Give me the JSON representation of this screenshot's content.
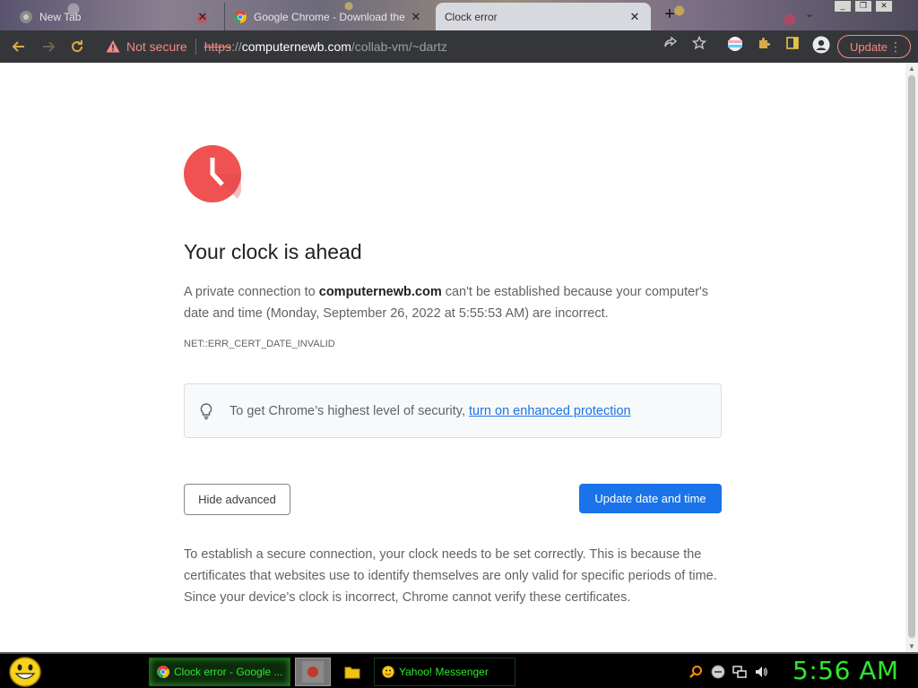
{
  "window": {
    "controls": {
      "minimize": "_",
      "restore": "❐",
      "close": "✕"
    }
  },
  "tabs": [
    {
      "title": "New Tab",
      "favicon": "chrome-gray-icon",
      "active": false
    },
    {
      "title": "Google Chrome - Download the",
      "favicon": "chrome-color-icon",
      "active": false
    },
    {
      "title": "Clock error",
      "favicon": "none",
      "active": true
    }
  ],
  "tabstrip": {
    "new_tab": "+",
    "tab_search": "⌄",
    "close_glyph": "✕"
  },
  "toolbar": {
    "security_label": "Not secure",
    "url": {
      "scheme": "https",
      "separator": "://",
      "host": "computernewb.com",
      "path": "/collab-vm/~dartz"
    },
    "update_label": "Update",
    "update_menu": "⋮"
  },
  "error_page": {
    "heading": "Your clock is ahead",
    "message_before": "A private connection to ",
    "message_host": "computernewb.com",
    "message_after": " can't be established because your computer's date and time (Monday, September 26, 2022 at 5:55:53 AM) are incorrect.",
    "error_code": "NET::ERR_CERT_DATE_INVALID",
    "enhanced_text": "To get Chrome’s highest level of security,",
    "enhanced_link": "turn on enhanced protection",
    "hide_advanced": "Hide advanced",
    "update_datetime": "Update date and time",
    "details": "To establish a secure connection, your clock needs to be set correctly. This is because the certificates that websites use to identify themselves are only valid for specific periods of time. Since your device's clock is incorrect, Chrome cannot verify these certificates."
  },
  "taskbar": {
    "tasks": [
      {
        "label": "Clock error - Google ...",
        "icon": "chrome-icon"
      },
      {
        "label": "",
        "icon": "thumbnail-icon"
      },
      {
        "label": "",
        "icon": "folder-icon"
      },
      {
        "label": "Yahoo! Messenger",
        "icon": "yahoo-messenger-icon"
      }
    ],
    "clock": "5:56 AM"
  },
  "colors": {
    "accent": "#1a73e8",
    "danger": "#f28b82",
    "clock_icon": "#f05252",
    "taskbar_text": "#2ee82e"
  }
}
